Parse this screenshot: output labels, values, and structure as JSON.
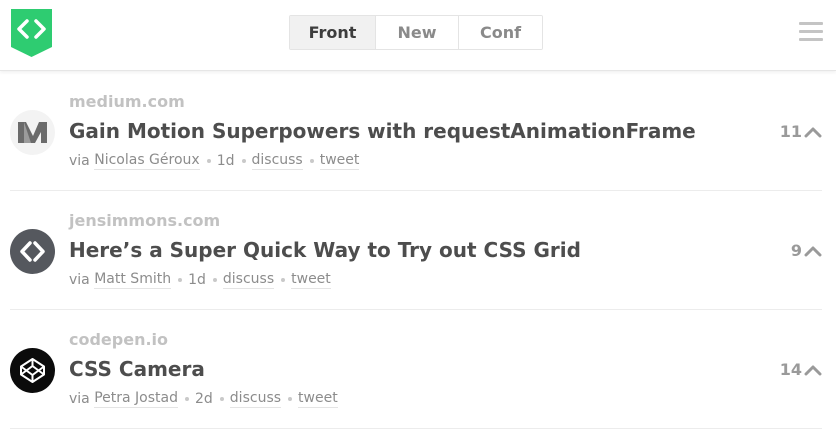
{
  "header": {
    "logo_icon": "code-brackets-icon",
    "logo_color": "#2ecc71",
    "tabs": [
      {
        "label": "Front",
        "active": true
      },
      {
        "label": "New",
        "active": false
      },
      {
        "label": "Conf",
        "active": false
      }
    ],
    "menu_icon": "hamburger-menu-icon"
  },
  "posts": [
    {
      "domain": "medium.com",
      "avatar_icon": "medium-logo-icon",
      "title": "Gain Motion Superpowers with requestAnimationFrame",
      "via": "via",
      "author": "Nicolas Géroux",
      "age": "1d",
      "discuss": "discuss",
      "tweet": "tweet",
      "votes": "11"
    },
    {
      "domain": "jensimmons.com",
      "avatar_icon": "code-brackets-icon",
      "title": "Here’s a Super Quick Way to Try out CSS Grid",
      "via": "via",
      "author": "Matt Smith",
      "age": "1d",
      "discuss": "discuss",
      "tweet": "tweet",
      "votes": "9"
    },
    {
      "domain": "codepen.io",
      "avatar_icon": "codepen-logo-icon",
      "title": "CSS Camera",
      "via": "via",
      "author": "Petra Jostad",
      "age": "2d",
      "discuss": "discuss",
      "tweet": "tweet",
      "votes": "14"
    }
  ]
}
